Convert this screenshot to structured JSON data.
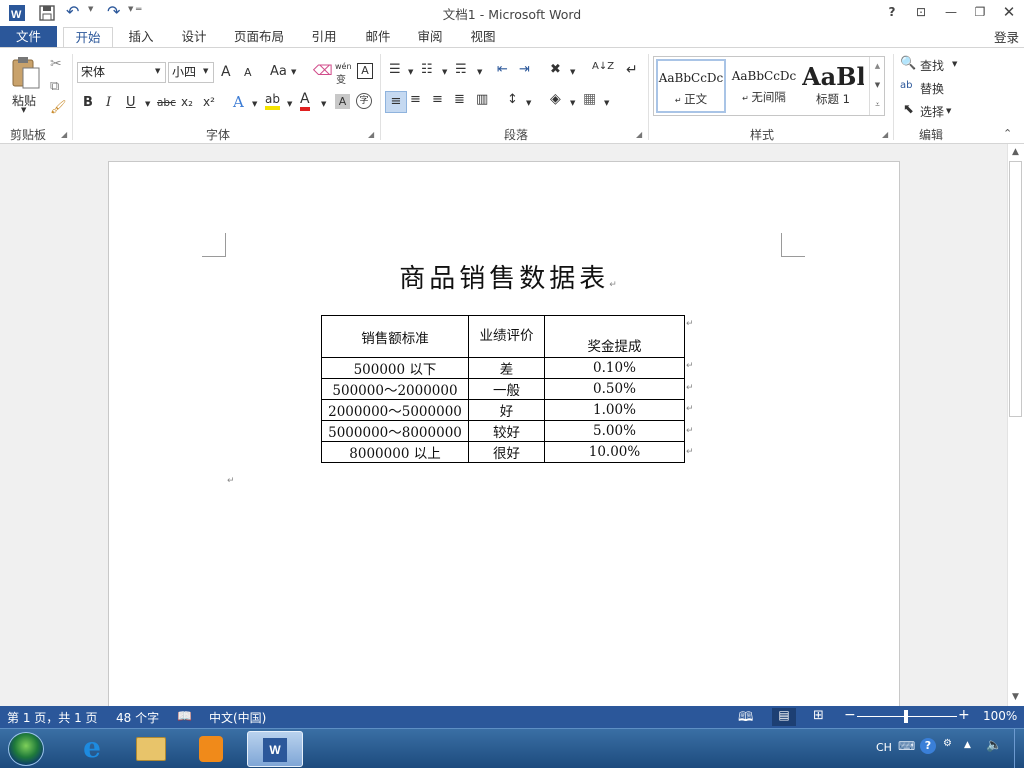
{
  "app": {
    "window_title": "文档1 - Microsoft Word",
    "help": "?",
    "login": "登录"
  },
  "tabs": [
    "文件",
    "开始",
    "插入",
    "设计",
    "页面布局",
    "引用",
    "邮件",
    "审阅",
    "视图"
  ],
  "ribbon": {
    "clipboard": {
      "label": "剪贴板",
      "paste": "粘贴"
    },
    "font": {
      "label": "字体",
      "font_name": "宋体",
      "font_size": "小四",
      "grow": "A",
      "shrink": "A",
      "case": "Aa",
      "phonetic": "wén",
      "phonetic_sub": "变",
      "bold": "B",
      "italic": "I",
      "underline": "U",
      "strike": "abc",
      "subscript": "x₂",
      "superscript": "x²"
    },
    "paragraph": {
      "label": "段落",
      "sort": "A↓Z"
    },
    "styles": {
      "label": "样式",
      "items": [
        {
          "preview": "AaBbCcDc",
          "name": "正文"
        },
        {
          "preview": "AaBbCcDc",
          "name": "无间隔"
        },
        {
          "preview": "AaBl",
          "name": "标题 1"
        }
      ]
    },
    "editing": {
      "label": "编辑",
      "find": "查找",
      "replace": "替换",
      "select": "选择"
    }
  },
  "document": {
    "title": "商品销售数据表",
    "table": {
      "headers": [
        "销售额标准",
        "业绩评价",
        "奖金提成"
      ],
      "rows": [
        [
          "500000 以下",
          "差",
          "0.10%"
        ],
        [
          "500000～2000000",
          "一般",
          "0.50%"
        ],
        [
          "2000000～5000000",
          "好",
          "1.00%"
        ],
        [
          "5000000～8000000",
          "较好",
          "5.00%"
        ],
        [
          "8000000 以上",
          "很好",
          "10.00%"
        ]
      ]
    }
  },
  "status": {
    "page": "第 1 页，共 1 页",
    "words": "48 个字",
    "language": "中文(中国)",
    "zoom": "100%"
  },
  "taskbar": {
    "ime": "CH"
  },
  "colors": {
    "accent": "#2b579a",
    "taskbar": "#2a5f97"
  }
}
